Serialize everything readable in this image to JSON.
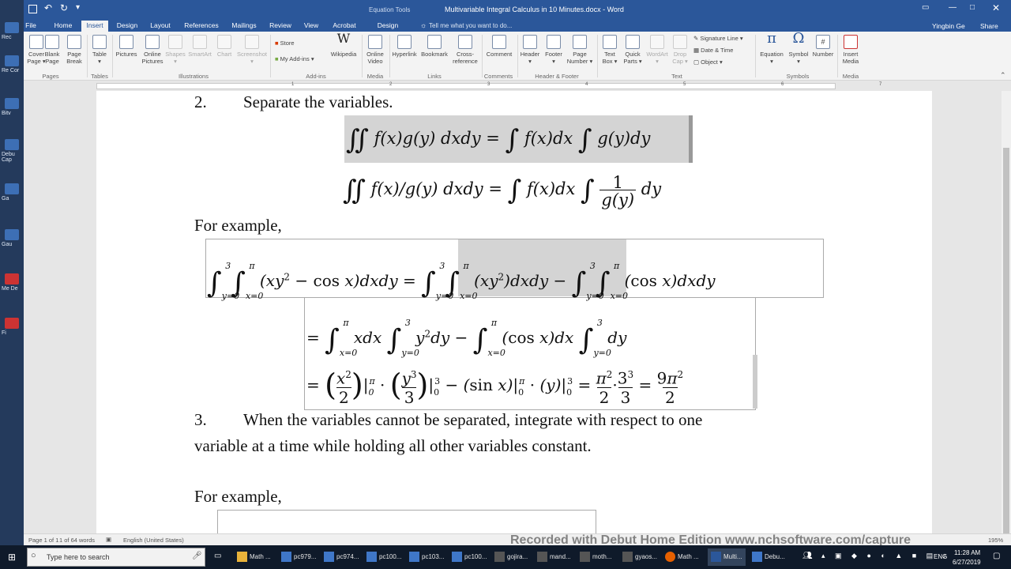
{
  "desktop": {
    "labels": [
      "Rec",
      "Re Cor",
      "Bitv",
      "Debu Cap",
      "Ga",
      "Gau",
      "Me De",
      "Fi"
    ]
  },
  "titlebar": {
    "equation_tools": "Equation Tools",
    "doc_title": "Multivariable Integral Calculus in 10 Minutes.docx - Word",
    "user": "Yingbin Ge",
    "share": "Share",
    "tell_me": "Tell me what you want to do..."
  },
  "tabs": [
    "File",
    "Home",
    "Insert",
    "Design",
    "Layout",
    "References",
    "Mailings",
    "Review",
    "View",
    "Acrobat",
    "Design"
  ],
  "ribbon": {
    "buttons": [
      {
        "label": "Cover Page",
        "sub": "▾"
      },
      {
        "label": "Blank Page",
        "sub": ""
      },
      {
        "label": "Page Break",
        "sub": ""
      },
      {
        "label": "Table",
        "sub": "▾"
      },
      {
        "label": "Pictures",
        "sub": ""
      },
      {
        "label": "Online Pictures",
        "sub": ""
      },
      {
        "label": "Shapes",
        "sub": "▾"
      },
      {
        "label": "SmartArt",
        "sub": ""
      },
      {
        "label": "Chart",
        "sub": ""
      },
      {
        "label": "Screenshot",
        "sub": "▾"
      },
      {
        "label": "Store",
        "sub": ""
      },
      {
        "label": "My Add-ins",
        "sub": "▾"
      },
      {
        "label": "Wikipedia",
        "sub": ""
      },
      {
        "label": "Online Video",
        "sub": ""
      },
      {
        "label": "Hyperlink",
        "sub": ""
      },
      {
        "label": "Bookmark",
        "sub": ""
      },
      {
        "label": "Cross-reference",
        "sub": ""
      },
      {
        "label": "Comment",
        "sub": ""
      },
      {
        "label": "Header",
        "sub": "▾"
      },
      {
        "label": "Footer",
        "sub": "▾"
      },
      {
        "label": "Page Number",
        "sub": "▾"
      },
      {
        "label": "Text Box",
        "sub": "▾"
      },
      {
        "label": "Quick Parts",
        "sub": "▾"
      },
      {
        "label": "WordArt",
        "sub": "▾"
      },
      {
        "label": "Drop Cap",
        "sub": "▾"
      },
      {
        "label": "Signature Line",
        "sub": "▾"
      },
      {
        "label": "Date & Time",
        "sub": ""
      },
      {
        "label": "Object",
        "sub": "▾"
      },
      {
        "label": "Equation",
        "sub": "▾"
      },
      {
        "label": "Symbol",
        "sub": "▾"
      },
      {
        "label": "Number",
        "sub": ""
      },
      {
        "label": "Insert Media",
        "sub": ""
      }
    ],
    "groups": [
      "Pages",
      "Tables",
      "Illustrations",
      "Add-ins",
      "Media",
      "Links",
      "Comments",
      "Header & Footer",
      "Text",
      "Symbols",
      "Media"
    ]
  },
  "ruler": {
    "ticks": [
      "1",
      "2",
      "3",
      "4",
      "5",
      "6",
      "7"
    ]
  },
  "document": {
    "step2": "2.",
    "step2_text": "Separate the variables.",
    "for_example_1": "For example,",
    "step3": "3.",
    "step3_line1": "When the variables cannot be separated, integrate with respect to one",
    "step3_line2": "variable at a time while holding all other variables constant.",
    "for_example_2": "For example,"
  },
  "status": {
    "page": "Page 1 of 1",
    "words": "1 of 64 words",
    "language": "English (United States)",
    "zoom": "195%"
  },
  "watermark": "Recorded with Debut Home Edition  www.nchsoftware.com/capture",
  "taskbar": {
    "search_placeholder": "Type here to search",
    "items": [
      "Math ...",
      "pc979...",
      "pc974...",
      "pc100...",
      "pc103...",
      "pc100...",
      "gojira...",
      "mand...",
      "moth...",
      "gyaos...",
      "Math ...",
      "Multi...",
      "Debu..."
    ],
    "lang": "ENG",
    "time": "11:28 AM",
    "date": "6/27/2019"
  }
}
